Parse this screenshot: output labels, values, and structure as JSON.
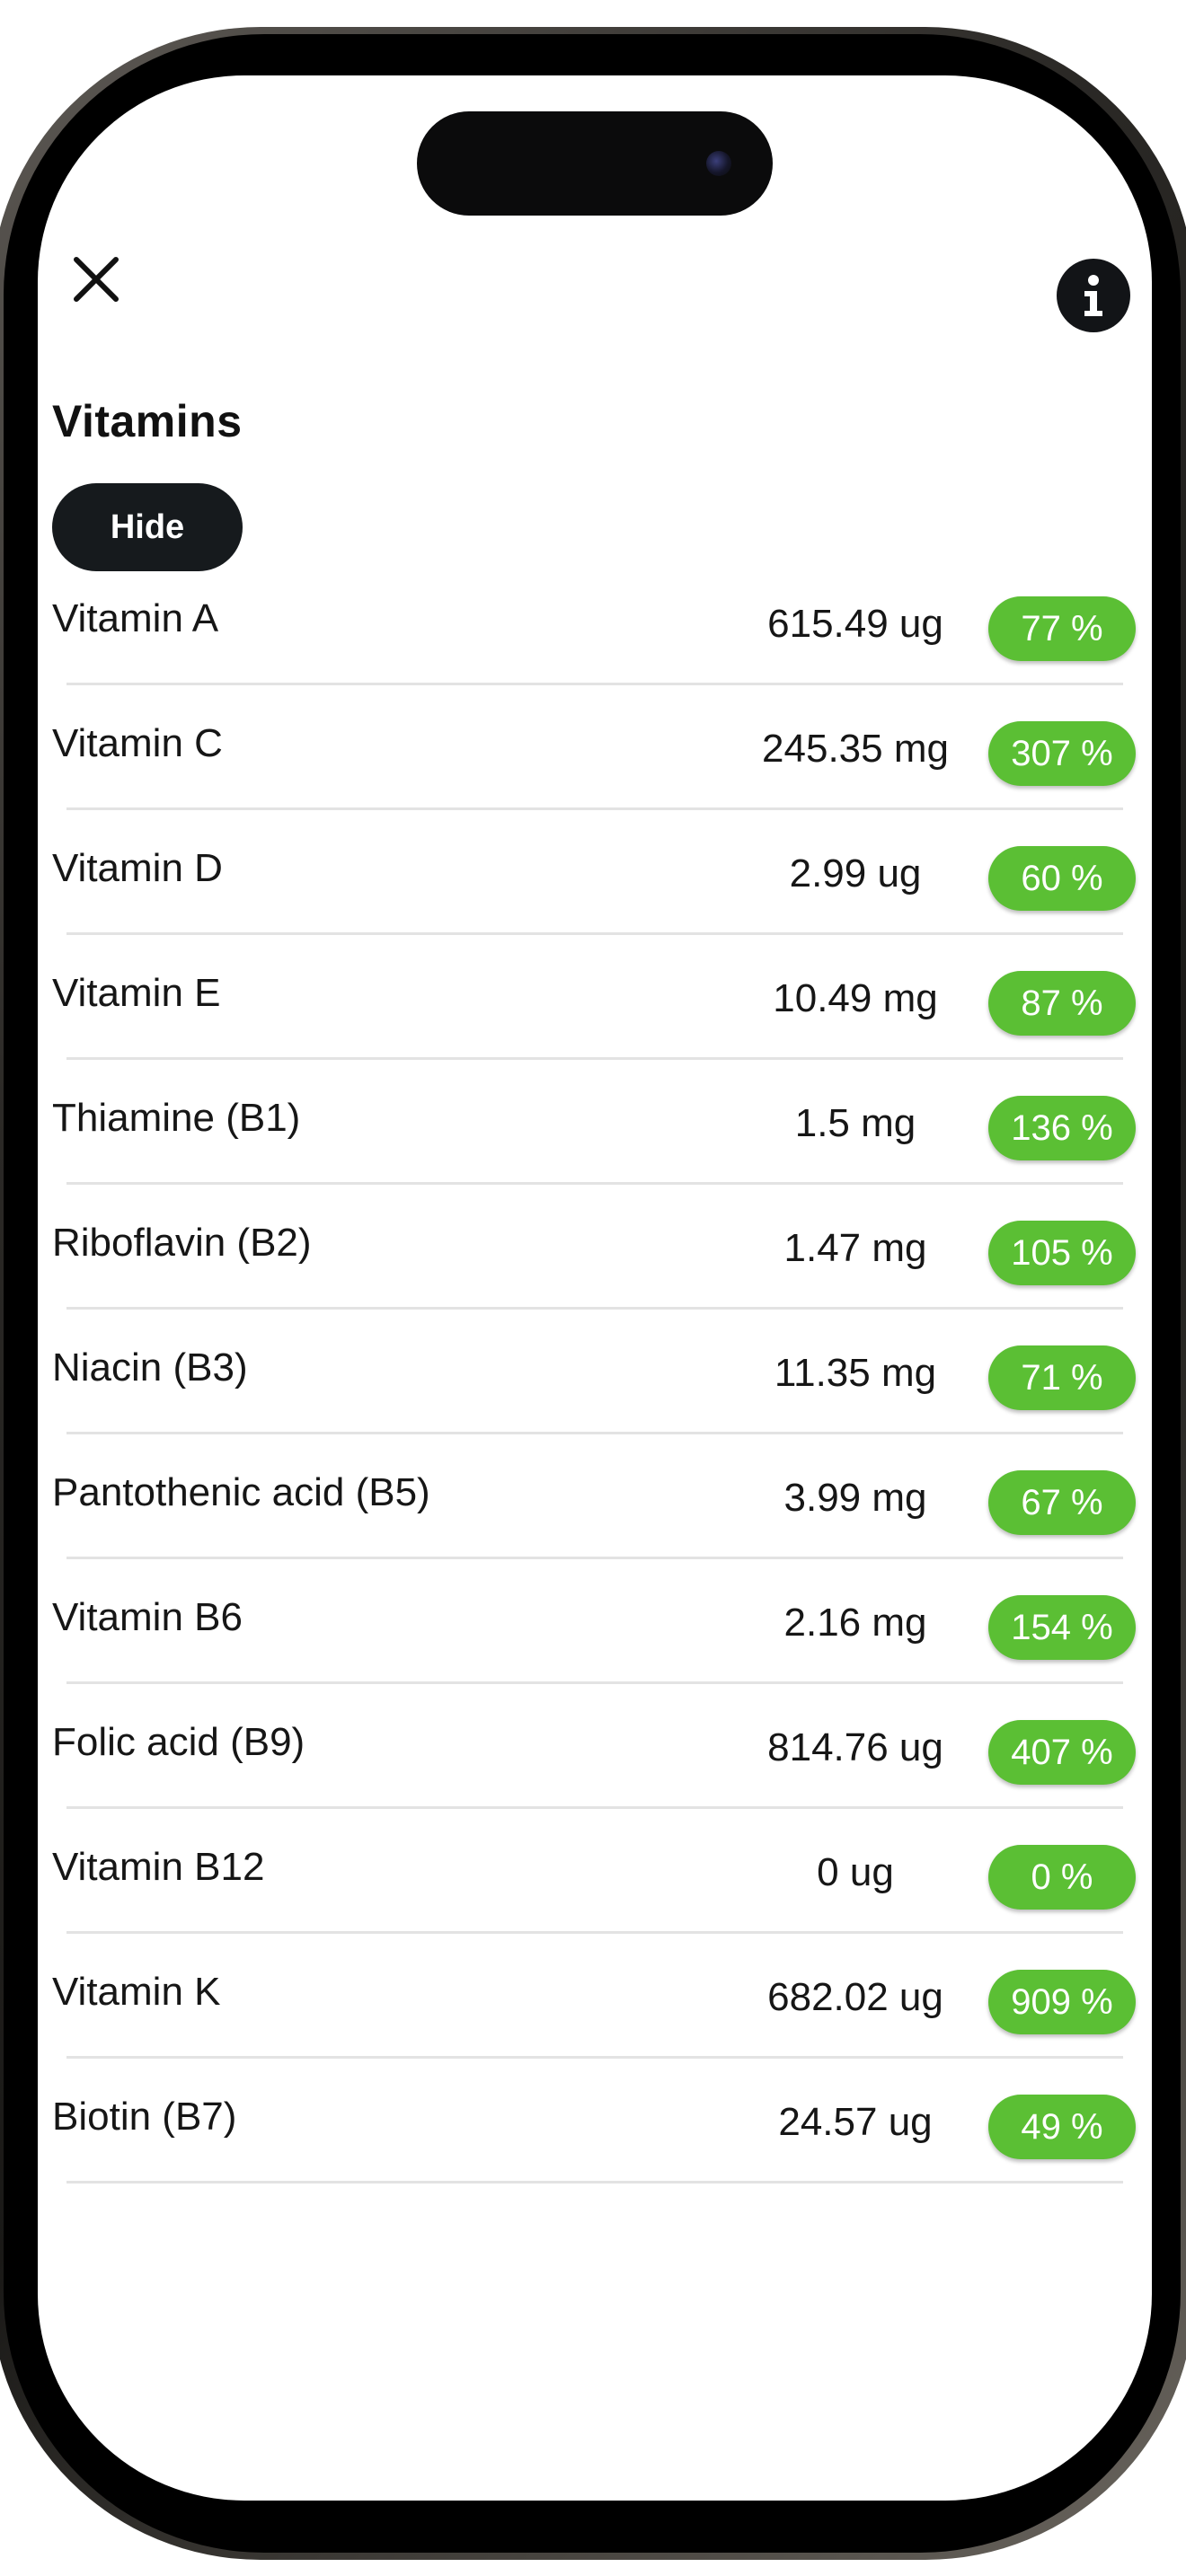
{
  "header": {
    "close_icon": "close-icon",
    "info_icon": "info-icon"
  },
  "section": {
    "title": "Vitamins",
    "toggle_label": "Hide"
  },
  "colors": {
    "badge_green": "#5bbf34",
    "dark_button": "#161a1d"
  },
  "vitamins": [
    {
      "name": "Vitamin A",
      "amount": "615.49 ug",
      "percent": "77 %"
    },
    {
      "name": "Vitamin C",
      "amount": "245.35 mg",
      "percent": "307 %"
    },
    {
      "name": "Vitamin D",
      "amount": "2.99 ug",
      "percent": "60 %"
    },
    {
      "name": "Vitamin E",
      "amount": "10.49 mg",
      "percent": "87 %"
    },
    {
      "name": "Thiamine (B1)",
      "amount": "1.5 mg",
      "percent": "136 %"
    },
    {
      "name": "Riboflavin (B2)",
      "amount": "1.47 mg",
      "percent": "105 %"
    },
    {
      "name": "Niacin (B3)",
      "amount": "11.35 mg",
      "percent": "71 %"
    },
    {
      "name": "Pantothenic acid (B5)",
      "amount": "3.99 mg",
      "percent": "67 %"
    },
    {
      "name": "Vitamin B6",
      "amount": "2.16 mg",
      "percent": "154 %"
    },
    {
      "name": "Folic acid (B9)",
      "amount": "814.76 ug",
      "percent": "407 %"
    },
    {
      "name": "Vitamin B12",
      "amount": "0 ug",
      "percent": "0 %"
    },
    {
      "name": "Vitamin K",
      "amount": "682.02 ug",
      "percent": "909 %"
    },
    {
      "name": "Biotin (B7)",
      "amount": "24.57 ug",
      "percent": "49 %"
    }
  ]
}
